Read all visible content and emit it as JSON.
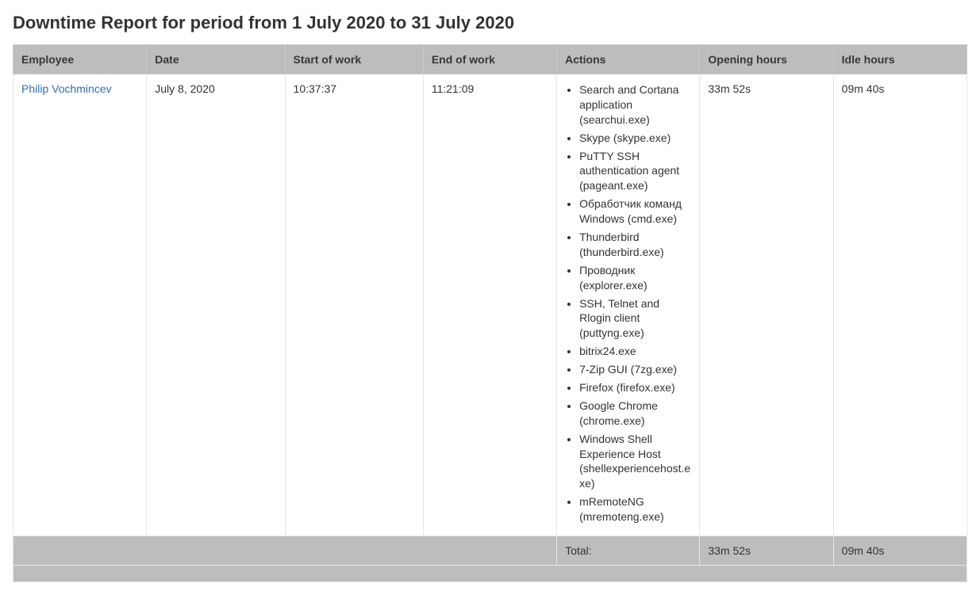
{
  "title": "Downtime Report for period from 1 July 2020 to 31 July 2020",
  "columns": {
    "employee": "Employee",
    "date": "Date",
    "start": "Start of work",
    "end": "End of work",
    "actions": "Actions",
    "opening": "Opening hours",
    "idle": "Idle hours"
  },
  "row": {
    "employee": "Philip Vochmincev",
    "date": "July 8, 2020",
    "start": "10:37:37",
    "end": "11:21:09",
    "opening": "33m 52s",
    "idle": "09m 40s",
    "actions": [
      "Search and Cortana application (searchui.exe)",
      "Skype (skype.exe)",
      "PuTTY SSH authentication agent (pageant.exe)",
      "Обработчик команд Windows (cmd.exe)",
      "Thunderbird (thunderbird.exe)",
      "Проводник (explorer.exe)",
      "SSH, Telnet and Rlogin client (puttyng.exe)",
      "bitrix24.exe",
      "7-Zip GUI (7zg.exe)",
      "Firefox (firefox.exe)",
      "Google Chrome (chrome.exe)",
      "Windows Shell Experience Host (shellexperiencehost.exe)",
      "mRemoteNG (mremoteng.exe)"
    ]
  },
  "totals": {
    "label": "Total:",
    "opening": "33m 52s",
    "idle": "09m 40s"
  }
}
